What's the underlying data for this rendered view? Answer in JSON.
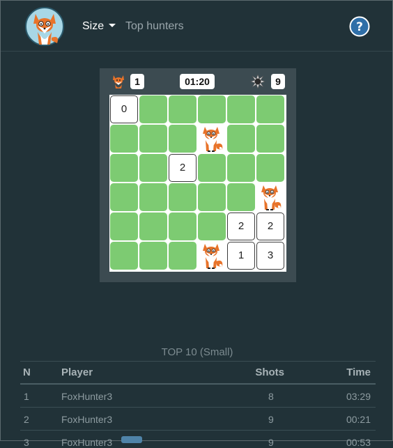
{
  "navbar": {
    "logo_icon": "fox-logo",
    "size_label": "Size",
    "top_hunters_label": "Top hunters",
    "help_icon": "question-circle-icon"
  },
  "status": {
    "foxes_found": "1",
    "timer": "01:20",
    "shots": "9"
  },
  "board": {
    "rows": [
      [
        "0",
        "",
        "",
        "",
        "",
        ""
      ],
      [
        "",
        "",
        "",
        "fox",
        "",
        ""
      ],
      [
        "",
        "",
        "2",
        "",
        "",
        ""
      ],
      [
        "",
        "",
        "",
        "",
        "",
        "fox"
      ],
      [
        "",
        "",
        "",
        "",
        "2",
        "2"
      ],
      [
        "",
        "",
        "",
        "fox",
        "1",
        "3"
      ]
    ],
    "cell_legend": {
      "": "closed",
      "fox": "fox"
    },
    "closed_color": "#7dcb72"
  },
  "top10": {
    "title": "TOP 10 (Small)",
    "headers": {
      "n": "N",
      "player": "Player",
      "shots": "Shots",
      "time": "Time"
    },
    "rows": [
      {
        "n": "1",
        "player": "FoxHunter3",
        "shots": "8",
        "time": "03:29"
      },
      {
        "n": "2",
        "player": "FoxHunter3",
        "shots": "9",
        "time": "00:21"
      },
      {
        "n": "3",
        "player": "FoxHunter3",
        "shots": "9",
        "time": "00:53"
      }
    ]
  }
}
